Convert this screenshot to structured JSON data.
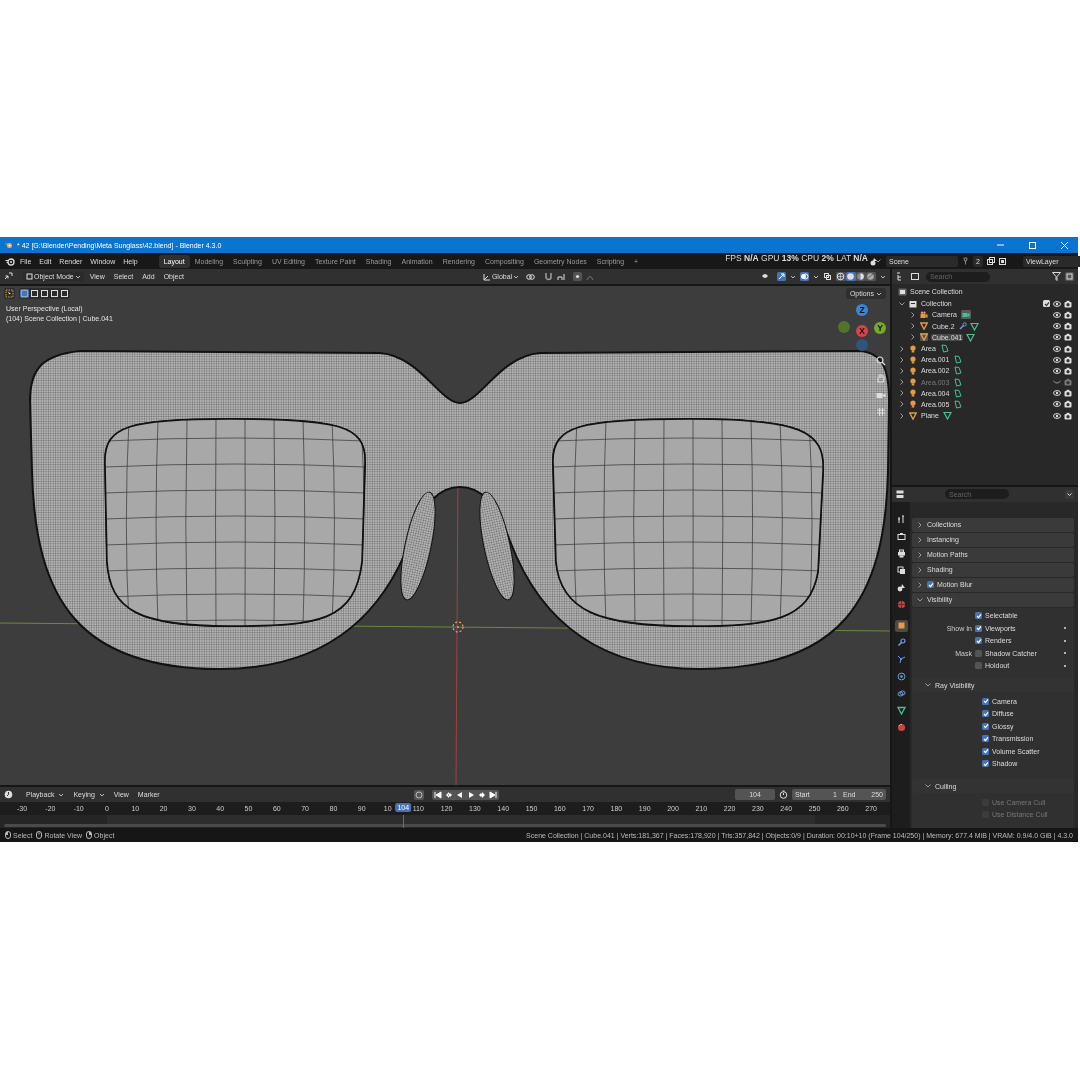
{
  "window": {
    "title": "* 42 [G:\\Blender\\Pending\\Meta Sunglass\\42.blend] - Blender 4.3.0"
  },
  "menu": [
    "File",
    "Edit",
    "Render",
    "Window",
    "Help"
  ],
  "workspaces": [
    {
      "label": "Layout",
      "selected": true
    },
    {
      "label": "Modeling",
      "selected": false
    },
    {
      "label": "Sculpting",
      "selected": false
    },
    {
      "label": "UV Editing",
      "selected": false
    },
    {
      "label": "Texture Paint",
      "selected": false
    },
    {
      "label": "Shading",
      "selected": false
    },
    {
      "label": "Animation",
      "selected": false
    },
    {
      "label": "Rendering",
      "selected": false
    },
    {
      "label": "Compositing",
      "selected": false
    },
    {
      "label": "Geometry Nodes",
      "selected": false
    },
    {
      "label": "Scripting",
      "selected": false
    }
  ],
  "add_workspace": "+",
  "stats": "FPS **N/A** GPU **13%** CPU **2%** LAT **N/A**",
  "scene": {
    "name": "Scene",
    "users": "2"
  },
  "view_layer": "ViewLayer",
  "viewport": {
    "mode": "Object Mode",
    "menus": [
      "View",
      "Select",
      "Add",
      "Object"
    ],
    "orientation": "Global",
    "toggles": [
      {
        "kind": "gizmo",
        "on": true
      },
      {
        "kind": "overlays",
        "on": true
      },
      {
        "kind": "xray",
        "on": false
      }
    ],
    "shading_modes": [
      {
        "kind": "wireframe",
        "selected": false
      },
      {
        "kind": "solid",
        "selected": true
      },
      {
        "kind": "material",
        "selected": false
      },
      {
        "kind": "rendered",
        "selected": false
      }
    ],
    "select_modes": [
      {
        "selected": true
      },
      {
        "selected": false
      },
      {
        "selected": false
      },
      {
        "selected": false
      },
      {
        "selected": false
      }
    ],
    "options": "Options",
    "info": [
      "User Perspective (Local)",
      "(104) Scene Collection | Cube.041"
    ],
    "gizmo_axes": [
      "Z",
      "X",
      "Y"
    ]
  },
  "outliner": {
    "search_placeholder": "Search",
    "root": "Scene Collection",
    "items": [
      {
        "name": "Collection",
        "kind": "collection",
        "expanded": true,
        "visible": true,
        "active": false,
        "modifier": false,
        "checked": true,
        "children": [
          {
            "name": "Camera",
            "kind": "camera",
            "expanded": false,
            "visible": true,
            "active": false,
            "modifier": false
          },
          {
            "name": "Cube.2",
            "kind": "mesh",
            "expanded": false,
            "visible": true,
            "active": false,
            "modifier": true
          },
          {
            "name": "Cube.041",
            "kind": "mesh",
            "expanded": false,
            "visible": true,
            "active": true,
            "modifier": false
          }
        ]
      },
      {
        "name": "Area",
        "kind": "light",
        "expanded": false,
        "visible": true,
        "active": false,
        "modifier": false
      },
      {
        "name": "Area.001",
        "kind": "light",
        "expanded": false,
        "visible": true,
        "active": false,
        "modifier": false
      },
      {
        "name": "Area.002",
        "kind": "light",
        "expanded": false,
        "visible": true,
        "active": false,
        "modifier": false
      },
      {
        "name": "Area.003",
        "kind": "light",
        "expanded": false,
        "visible": false,
        "active": false,
        "modifier": false
      },
      {
        "name": "Area.004",
        "kind": "light",
        "expanded": false,
        "visible": true,
        "active": false,
        "modifier": false
      },
      {
        "name": "Area.005",
        "kind": "light",
        "expanded": false,
        "visible": true,
        "active": false,
        "modifier": false
      },
      {
        "name": "Plane",
        "kind": "mesh",
        "expanded": false,
        "visible": true,
        "active": false,
        "modifier": false
      }
    ]
  },
  "properties": {
    "search_placeholder": "Search",
    "tabs": [
      {
        "kind": "tool",
        "selected": false
      },
      {
        "kind": "render",
        "selected": false
      },
      {
        "kind": "output",
        "selected": false
      },
      {
        "kind": "view-layer",
        "selected": false
      },
      {
        "kind": "scene",
        "selected": false
      },
      {
        "kind": "world",
        "selected": false
      },
      {
        "kind": "object",
        "selected": true
      },
      {
        "kind": "modifier",
        "selected": false
      },
      {
        "kind": "particles",
        "selected": false
      },
      {
        "kind": "physics",
        "selected": false
      },
      {
        "kind": "constraints",
        "selected": false
      },
      {
        "kind": "data",
        "selected": false
      },
      {
        "kind": "material",
        "selected": false
      }
    ],
    "panels": [
      {
        "label": "Collections",
        "kind": "plain",
        "expanded": false
      },
      {
        "label": "Instancing",
        "kind": "plain",
        "expanded": false
      },
      {
        "label": "Motion Paths",
        "kind": "plain",
        "expanded": false
      },
      {
        "label": "Shading",
        "kind": "plain",
        "expanded": false
      },
      {
        "label": "Motion Blur",
        "kind": "toggle",
        "checked": true,
        "expanded": false
      },
      {
        "label": "Visibility",
        "kind": "plain",
        "expanded": true,
        "rows": [
          {
            "label": "",
            "text": "Selectable",
            "checked": true,
            "disabled": false,
            "animatable": false
          },
          {
            "label": "Show In",
            "text": "Viewports",
            "checked": true,
            "disabled": false,
            "animatable": true
          },
          {
            "label": "",
            "text": "Renders",
            "checked": true,
            "disabled": false,
            "animatable": true
          },
          {
            "label": "Mask",
            "text": "Shadow Catcher",
            "checked": false,
            "disabled": false,
            "animatable": true
          },
          {
            "label": "",
            "text": "Holdout",
            "checked": false,
            "disabled": false,
            "animatable": true
          }
        ],
        "subpanels": [
          {
            "label": "Ray Visibility",
            "expanded": true,
            "rows": [
              {
                "text": "Camera",
                "checked": true,
                "disabled": false
              },
              {
                "text": "Diffuse",
                "checked": true,
                "disabled": false
              },
              {
                "text": "Glossy",
                "checked": true,
                "disabled": false
              },
              {
                "text": "Transmission",
                "checked": true,
                "disabled": false
              },
              {
                "text": "Volume Scatter",
                "checked": true,
                "disabled": false
              },
              {
                "text": "Shadow",
                "checked": true,
                "disabled": false
              }
            ]
          },
          {
            "label": "Culling",
            "expanded": true,
            "rows": [
              {
                "text": "Use Camera Cull",
                "checked": false,
                "disabled": true
              },
              {
                "text": "Use Distance Cull",
                "checked": false,
                "disabled": true
              }
            ]
          }
        ]
      }
    ]
  },
  "timeline": {
    "menus": [
      "Playback",
      "Keying",
      "View",
      "Marker"
    ],
    "current_frame": "104",
    "start_label": "Start",
    "start": "1",
    "end_label": "End",
    "end": "250",
    "ticks": [
      "-30",
      "-20",
      "-10",
      "0",
      "10",
      "20",
      "30",
      "40",
      "50",
      "60",
      "70",
      "80",
      "90",
      "10",
      "110",
      "120",
      "130",
      "140",
      "150",
      "160",
      "170",
      "180",
      "190",
      "200",
      "210",
      "220",
      "230",
      "240",
      "250",
      "260",
      "270"
    ],
    "playhead": "104"
  },
  "status_bar": {
    "hints": [
      "Select",
      "Rotate View",
      "Object"
    ],
    "info": "Scene Collection | Cube.041 | Verts:181,367 | Faces:178,920 | Tris:357,842 | Objects:0/9 | Duration: 00:10+10 (Frame 104/250) | Memory: 677.4 MiB | VRAM: 0.9/4.0 GiB | 4.3.0"
  }
}
